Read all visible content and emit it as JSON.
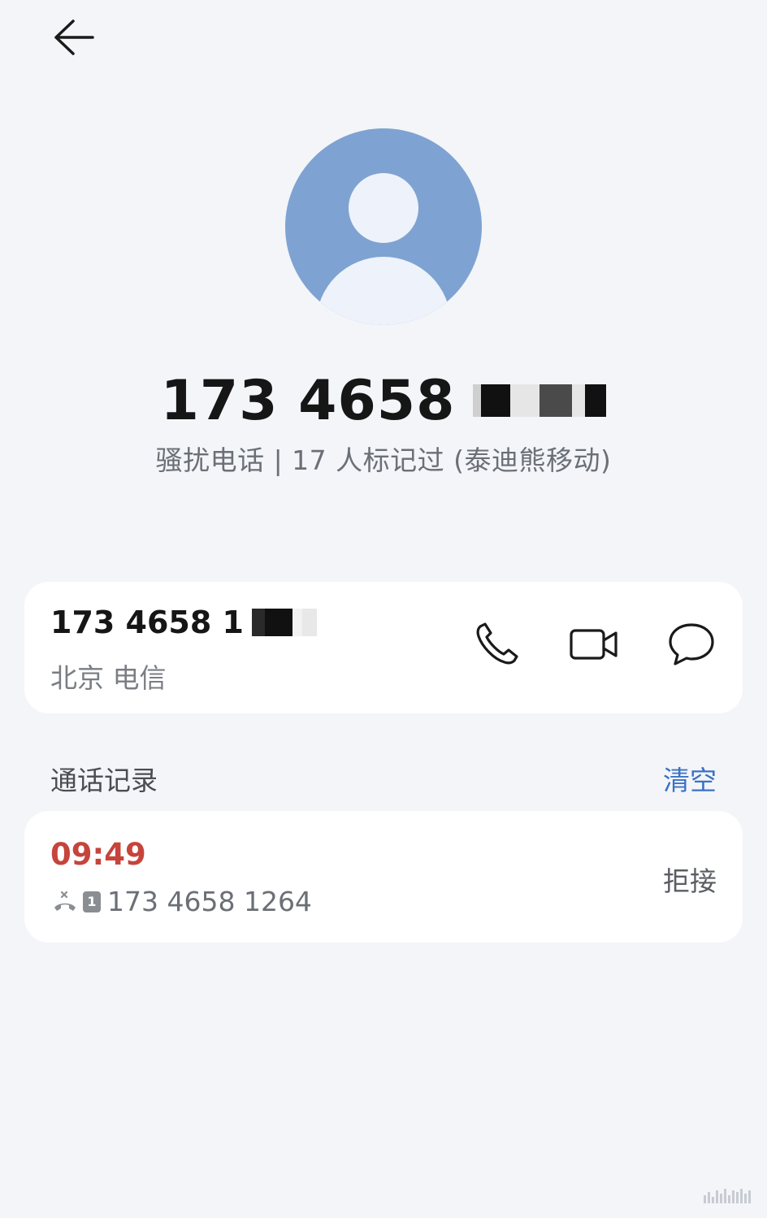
{
  "header": {
    "back_icon": "arrow-left-icon"
  },
  "contact": {
    "avatar_icon": "person-avatar-icon",
    "number": "173 4658",
    "subtitle": "骚扰电话 | 17 人标记过 (泰迪熊移动)"
  },
  "number_card": {
    "number": "173 4658 1",
    "location": "北京 电信",
    "actions": {
      "call_icon": "phone-icon",
      "video_icon": "video-camera-icon",
      "message_icon": "message-bubble-icon"
    }
  },
  "call_log": {
    "title": "通话记录",
    "clear_label": "清空",
    "entries": [
      {
        "time": "09:49",
        "number": "173 4658 1264",
        "status": "拒接",
        "type_icon": "rejected-call-icon",
        "sim": "1"
      }
    ]
  },
  "colors": {
    "background": "#f3f5f9",
    "avatar": "#7ea3d2",
    "accent": "#3b72c4",
    "missed": "#c6443c"
  }
}
